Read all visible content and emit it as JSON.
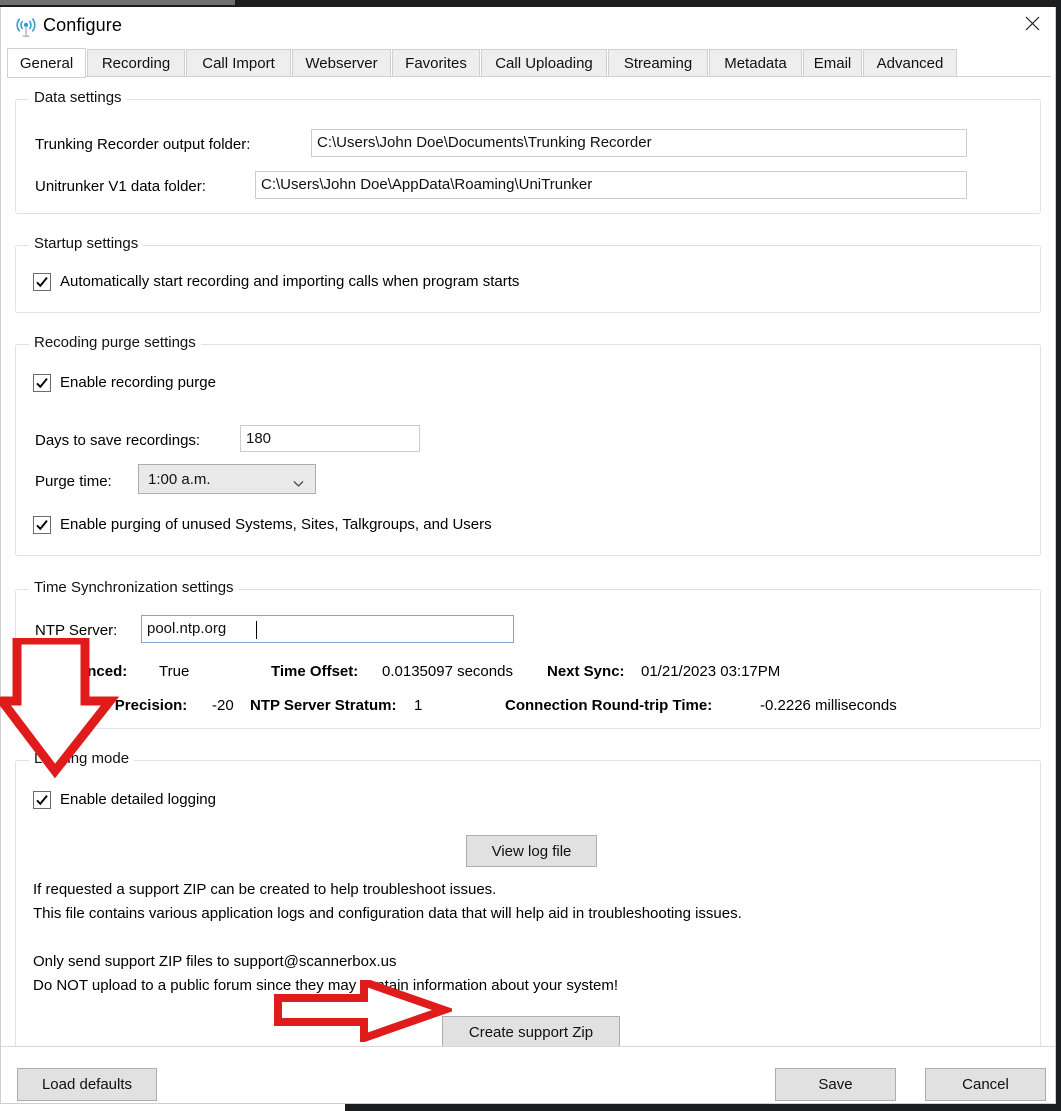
{
  "window": {
    "title": "Configure",
    "icon": "broadcast-antenna-icon",
    "close_label": "×"
  },
  "tabs": [
    {
      "label": "General",
      "active": true
    },
    {
      "label": "Recording",
      "active": false
    },
    {
      "label": "Call Import",
      "active": false
    },
    {
      "label": "Webserver",
      "active": false
    },
    {
      "label": "Favorites",
      "active": false
    },
    {
      "label": "Call Uploading",
      "active": false
    },
    {
      "label": "Streaming",
      "active": false
    },
    {
      "label": "Metadata",
      "active": false
    },
    {
      "label": "Email",
      "active": false
    },
    {
      "label": "Advanced",
      "active": false
    }
  ],
  "data_settings": {
    "title": "Data settings",
    "output_folder_label": "Trunking Recorder output folder:",
    "output_folder_value": "C:\\Users\\John Doe\\Documents\\Trunking Recorder",
    "unitrunker_label": "Unitrunker V1 data folder:",
    "unitrunker_value": "C:\\Users\\John Doe\\AppData\\Roaming\\UniTrunker"
  },
  "startup_settings": {
    "title": "Startup settings",
    "autostart_label": "Automatically start recording and importing calls when program starts",
    "autostart_checked": true
  },
  "purge_settings": {
    "title": "Recoding purge settings",
    "enable_purge_label": "Enable recording purge",
    "enable_purge_checked": true,
    "days_label": "Days to save recordings:",
    "days_value": "180",
    "purge_time_label": "Purge time:",
    "purge_time_value": "1:00 a.m.",
    "purge_time_options": [
      "1:00 a.m."
    ],
    "unused_label": "Enable purging of unused Systems, Sites, Talkgroups, and Users",
    "unused_checked": true
  },
  "time_sync": {
    "title": "Time Synchronization settings",
    "ntp_server_label": "NTP Server:",
    "ntp_server_value": "pool.ntp.org",
    "row1": [
      {
        "key": "Time Synced:",
        "value": "True"
      },
      {
        "key": "Time Offset:",
        "value": "0.0135097 seconds"
      },
      {
        "key": "Next Sync:",
        "value": "01/21/2023 03:17PM"
      }
    ],
    "row2": [
      {
        "key": "NTP Server Precision:",
        "value": "-20"
      },
      {
        "key": "NTP Server Stratum:",
        "value": "1"
      },
      {
        "key": "Connection Round-trip Time:",
        "value": "-0.2226 milliseconds"
      }
    ]
  },
  "logging": {
    "title": "Logging mode",
    "enable_logging_label": "Enable detailed logging",
    "enable_logging_checked": true,
    "view_log_button": "View log file",
    "info_line1": "If requested a support ZIP can be created to help troubleshoot issues.",
    "info_line2": "This file contains various application logs and configuration data that will help aid in troubleshooting issues.",
    "info_line3": "Only send support ZIP files to support@scannerbox.us",
    "info_line4": "Do NOT upload to a public forum since they may contain information about your system!",
    "create_zip_button": "Create support Zip"
  },
  "footer": {
    "load_defaults": "Load defaults",
    "save": "Save",
    "cancel": "Cancel"
  },
  "annotations": {
    "color": "#e01b1b",
    "down_arrow_target": "Time Synced / NTP Server Precision rows",
    "right_arrow_target": "Create support Zip"
  }
}
